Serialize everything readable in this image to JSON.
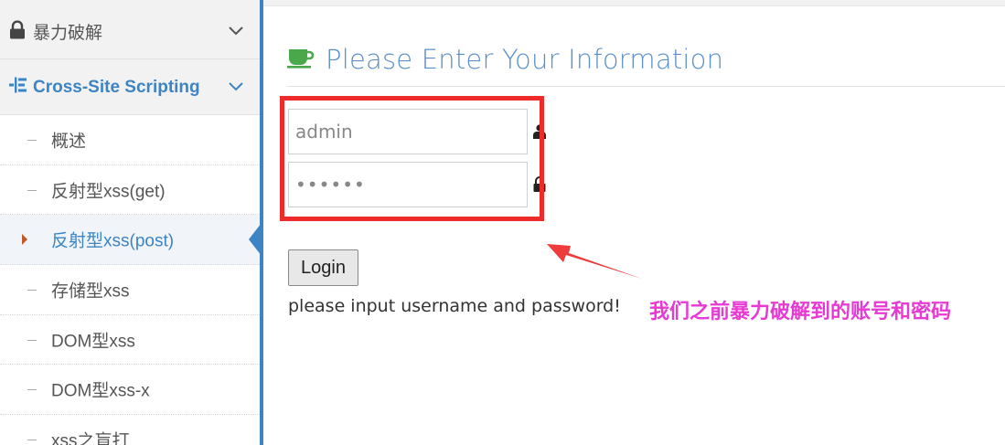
{
  "sidebar": {
    "sections": [
      {
        "label": "暴力破解",
        "icon": "lock-icon"
      },
      {
        "label": "Cross-Site Scripting",
        "icon": "sitemap-icon"
      }
    ],
    "items": [
      {
        "label": "概述"
      },
      {
        "label": "反射型xss(get)"
      },
      {
        "label": "反射型xss(post)"
      },
      {
        "label": "存储型xss"
      },
      {
        "label": "DOM型xss"
      },
      {
        "label": "DOM型xss-x"
      },
      {
        "label": "xss之盲打"
      }
    ],
    "active_index": 2
  },
  "main": {
    "title": "Please Enter Your Information",
    "title_icon": "coffee-cup-icon",
    "username_value": "admin",
    "password_value": "••••••",
    "login_label": "Login",
    "status_message": "please input username and password!"
  },
  "annotation": {
    "text": "我们之前暴力破解到的账号和密码",
    "color": "#e63ad3"
  },
  "colors": {
    "accent": "#3c84c3",
    "highlight_box": "#ee2b2b"
  }
}
